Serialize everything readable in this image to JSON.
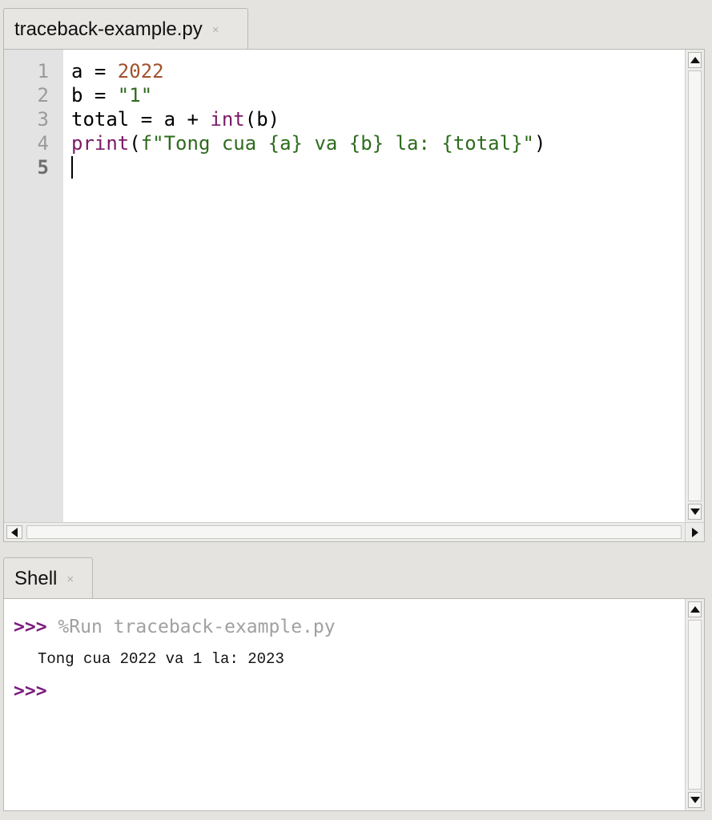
{
  "editor": {
    "tab": {
      "title": "traceback-example.py",
      "close": "×"
    },
    "line_numbers": [
      "1",
      "2",
      "3",
      "4",
      "5"
    ],
    "active_line": "5",
    "code": [
      [
        {
          "t": "a = ",
          "c": ""
        },
        {
          "t": "2022",
          "c": "num"
        }
      ],
      [
        {
          "t": "b = ",
          "c": ""
        },
        {
          "t": "\"1\"",
          "c": "str"
        }
      ],
      [
        {
          "t": "total = a + ",
          "c": ""
        },
        {
          "t": "int",
          "c": "kw"
        },
        {
          "t": "(b)",
          "c": ""
        }
      ],
      [
        {
          "t": "print",
          "c": "kw"
        },
        {
          "t": "(",
          "c": ""
        },
        {
          "t": "f\"Tong cua {a} va {b} la: {total}\"",
          "c": "str"
        },
        {
          "t": ")",
          "c": ""
        }
      ],
      []
    ]
  },
  "shell": {
    "tab": {
      "title": "Shell",
      "close": "×"
    },
    "prompt": ">>>",
    "command": "%Run traceback-example.py",
    "output": "Tong cua 2022 va 1 la: 2023",
    "prompt2": ">>>"
  },
  "colors": {
    "number": "#a0522d",
    "string": "#2e6b1e",
    "keyword": "#7a1a66",
    "prompt": "#7b1b7e"
  }
}
